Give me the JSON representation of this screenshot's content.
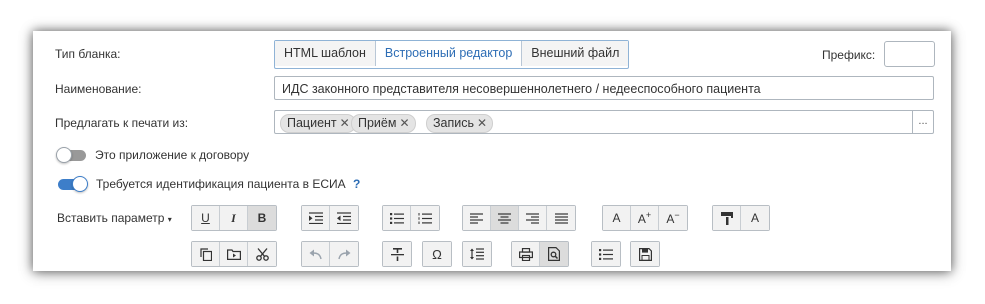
{
  "form": {
    "blank_type_label": "Тип бланка:",
    "blank_type_options": [
      "HTML шаблон",
      "Встроенный редактор",
      "Внешний файл"
    ],
    "blank_type_selected": "Встроенный редактор",
    "prefix_label": "Префикс:",
    "prefix_value": "",
    "name_label": "Наименование:",
    "name_value": "ИДС законного представителя несовершеннолетнего / недееспособного пациента",
    "print_from_label": "Предлагать к печати из:",
    "print_from_tags": [
      "Пациент",
      "Приём",
      "Запись"
    ],
    "print_from_more": "...",
    "contract_attachment_label": "Это приложение к договору",
    "contract_attachment_on": false,
    "esia_label": "Требуется идентификация пациента в ЕСИА",
    "esia_on": true,
    "esia_help": "?"
  },
  "toolbar": {
    "insert_param_label": "Вставить параметр",
    "underline": "U",
    "italic": "I",
    "bold": "B",
    "font_size": "A",
    "font_larger": "A",
    "font_smaller": "A",
    "font_color": "A",
    "special_char": "Ω"
  },
  "colors": {
    "accent": "#2d6db5",
    "toggle_on": "#3d7ec9",
    "toggle_off": "#999999"
  }
}
